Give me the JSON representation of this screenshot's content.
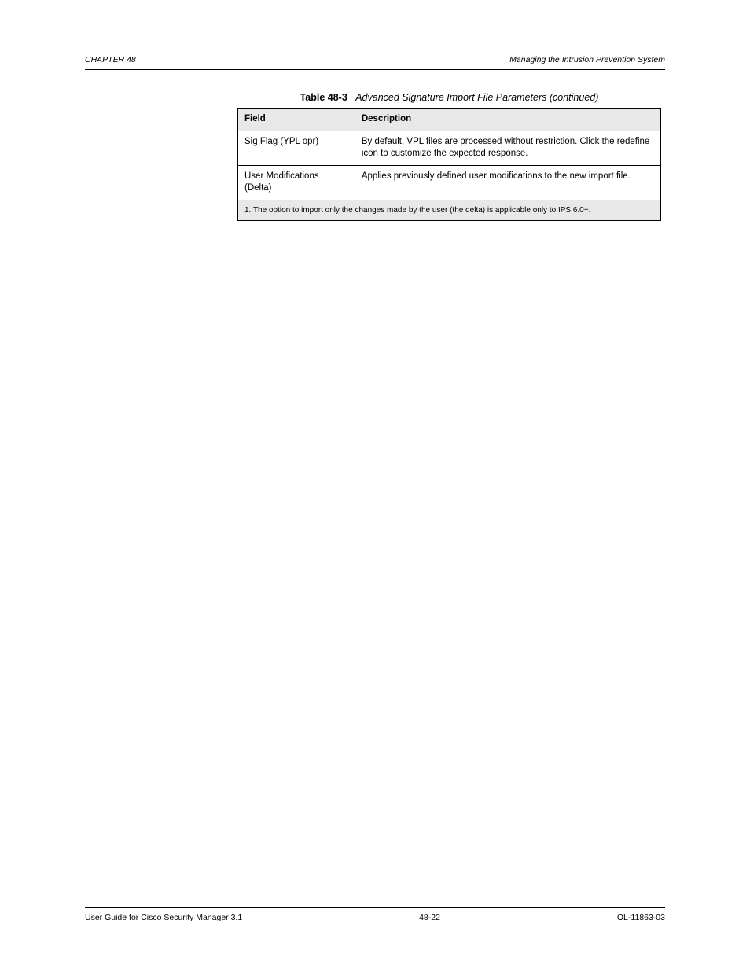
{
  "header": {
    "left": "CHAPTER 48",
    "right": "Managing the Intrusion Prevention System"
  },
  "table": {
    "caption_strong": "Table 48-3",
    "caption_rest": "Advanced Signature Import File Parameters (continued)",
    "columns": [
      "Field",
      "Description"
    ],
    "rows": [
      {
        "field": "Sig Flag (YPL opr)",
        "desc": "By default, VPL files are processed without restriction. Click the redefine icon to customize the expected response."
      },
      {
        "field": "User Modifications (Delta)",
        "desc": "Applies previously defined user modifications to the new import file."
      }
    ],
    "footnote": "1. The option to import only the changes made by the user (the delta) is applicable only to IPS 6.0+."
  },
  "footer": {
    "left": "User Guide for Cisco Security Manager 3.1",
    "middle": "48-22",
    "right": "OL-11863-03"
  }
}
